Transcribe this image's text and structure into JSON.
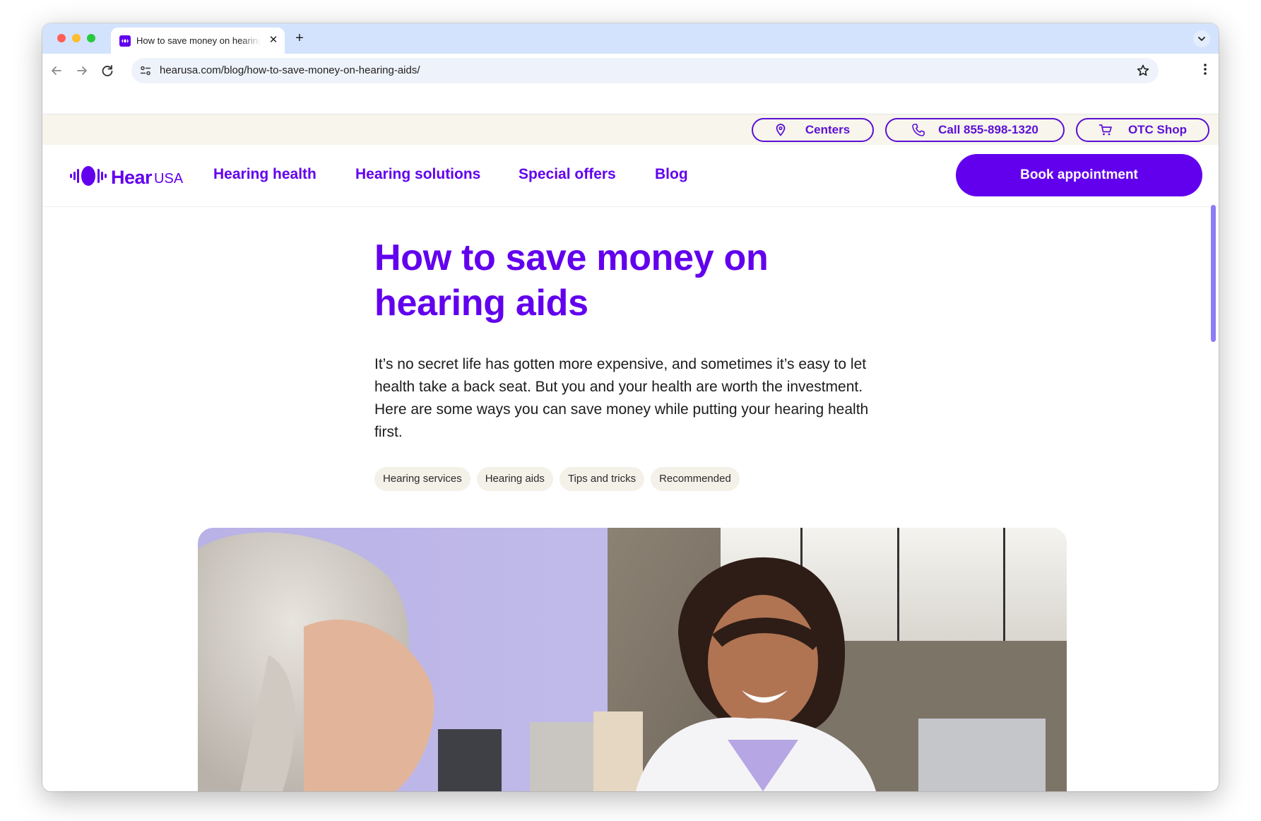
{
  "browser": {
    "tab_title": "How to save money on hearing aids",
    "tab_close": "✕",
    "new_tab": "+",
    "url_domain": "hearusa.com",
    "url_path": "/blog/how-to-save-money-on-hearing-aids/"
  },
  "utility": {
    "centers_label": "Centers",
    "call_label": "Call 855-898-1320",
    "shop_label": "OTC Shop"
  },
  "nav": {
    "logo_hear": "Hear",
    "logo_usa": "USA",
    "links": [
      "Hearing health",
      "Hearing solutions",
      "Special offers",
      "Blog"
    ],
    "cta": "Book appointment"
  },
  "article": {
    "title": "How to save money on hearing aids",
    "intro": "It’s no secret life has gotten more expensive, and sometimes it’s easy to let health take a back seat. But you and your health are worth the investment. Here are some ways you can save money while putting your hearing health first.",
    "tags": [
      "Hearing services",
      "Hearing aids",
      "Tips and tricks",
      "Recommended"
    ]
  },
  "colors": {
    "brand": "#6200ee",
    "utility_bg": "#f7f5ec",
    "tab_strip": "#d3e3fd"
  },
  "icons": [
    "location-pin-icon",
    "phone-icon",
    "cart-icon",
    "back-arrow-icon",
    "forward-arrow-icon",
    "reload-icon",
    "site-settings-icon",
    "bookmark-star-icon",
    "menu-kebab-icon",
    "tab-search-icon"
  ]
}
